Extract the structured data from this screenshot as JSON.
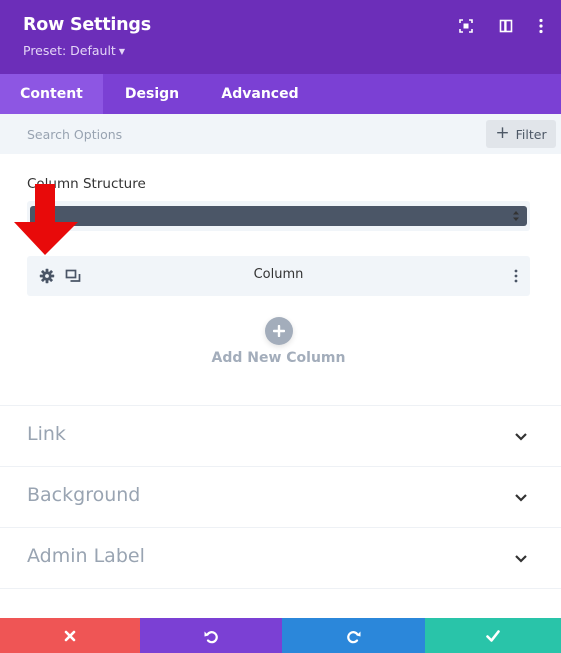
{
  "header": {
    "title": "Row Settings",
    "preset": "Preset: Default",
    "icons": [
      "expand-icon",
      "sidebar-icon",
      "more-vertical-icon"
    ],
    "background": "#6c2eb9"
  },
  "tabs": [
    {
      "label": "Content",
      "active": true
    },
    {
      "label": "Design",
      "active": false
    },
    {
      "label": "Advanced",
      "active": false
    }
  ],
  "search": {
    "placeholder": "Search Options",
    "filter_label": "Filter"
  },
  "column_structure": {
    "label": "Column Structure",
    "columns": [
      {
        "label": "Column"
      }
    ]
  },
  "add_column": {
    "label": "Add New Column"
  },
  "sections": [
    {
      "label": "Link"
    },
    {
      "label": "Background"
    },
    {
      "label": "Admin Label"
    }
  ],
  "footer": {
    "buttons": [
      {
        "name": "discard-button",
        "icon": "close-icon",
        "color": "#ef5555"
      },
      {
        "name": "undo-button",
        "icon": "undo-icon",
        "color": "#7b40d4"
      },
      {
        "name": "redo-button",
        "icon": "redo-icon",
        "color": "#2b87da"
      },
      {
        "name": "save-button",
        "icon": "check-icon",
        "color": "#29c4a9"
      }
    ]
  },
  "colors": {
    "accent": "#7b40d4",
    "arrow": "#e80a0a"
  }
}
